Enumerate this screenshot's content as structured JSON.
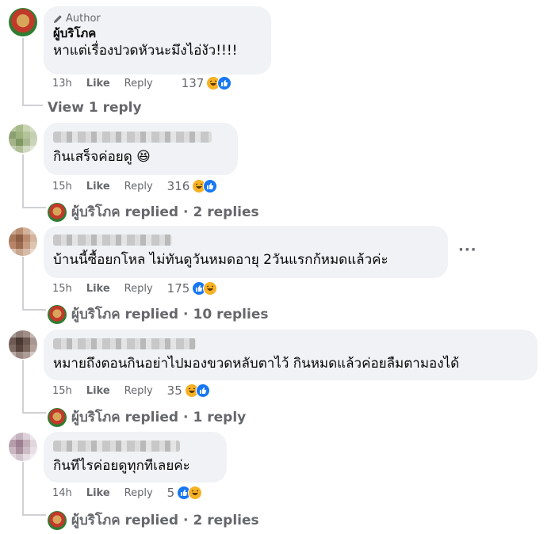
{
  "author_comment": {
    "badge": "Author",
    "name": "ผู้บริโภค",
    "text": "หาแต่เรื่องปวดหัวนะมึงไอ่งัว!!!!",
    "time": "13h",
    "like": "Like",
    "reply": "Reply",
    "reaction_count": "137",
    "view_replies": "View 1 reply"
  },
  "comments": [
    {
      "text": "กินเสร็จค่อยดู 😆",
      "time": "15h",
      "like": "Like",
      "reply": "Reply",
      "reaction_count": "316",
      "replied_name": "ผู้บริโภค",
      "replied_label": "replied",
      "replied_sep": "·",
      "replies": "2 replies"
    },
    {
      "text": "บ้านนี้ซื้อยกโหล ไม่ทันดูวันหมดอายุ 2วันแรกก้หมดแล้วค่ะ",
      "time": "15h",
      "like": "Like",
      "reply": "Reply",
      "reaction_count": "175",
      "replied_name": "ผู้บริโภค",
      "replied_label": "replied",
      "replied_sep": "·",
      "replies": "10 replies"
    },
    {
      "text": "หมายถึงตอนกินอย่าไปมองขวดหลับตาไว้ กินหมดแล้วค่อยลืมตามองได้",
      "time": "15h",
      "like": "Like",
      "reply": "Reply",
      "reaction_count": "35",
      "replied_name": "ผู้บริโภค",
      "replied_label": "replied",
      "replied_sep": "·",
      "replies": "1 reply"
    },
    {
      "text": "กินทีไรค่อยดูทุกทีเลยค่ะ",
      "time": "14h",
      "like": "Like",
      "reply": "Reply",
      "reaction_count": "5",
      "replied_name": "ผู้บริโภค",
      "replied_label": "replied",
      "replied_sep": "·",
      "replies": "2 replies"
    }
  ],
  "more_options": "···",
  "colors": {
    "bubble": "#f0f2f5",
    "meta": "#65676b",
    "like_blue": "#1877f2",
    "haha_yellow": "#f7b125"
  },
  "icons": [
    "pencil-icon",
    "haha-reaction-icon",
    "like-reaction-icon",
    "more-options-icon"
  ]
}
